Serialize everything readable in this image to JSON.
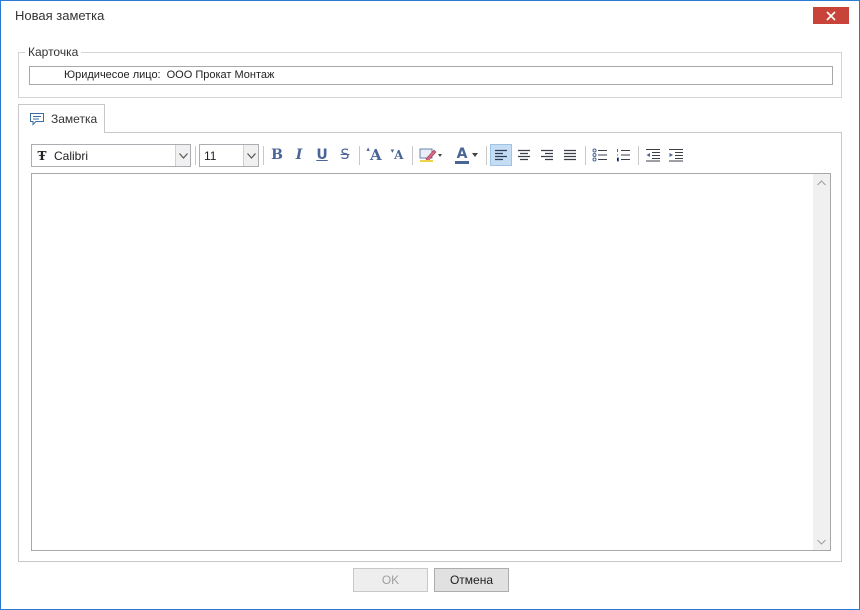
{
  "window": {
    "title": "Новая заметка"
  },
  "card": {
    "legend": "Карточка",
    "entity_label": "Юридичесое лицо:",
    "entity_value": "ООО Прокат Монтаж"
  },
  "tab": {
    "label": "Заметка"
  },
  "toolbar": {
    "font_family": "Calibri",
    "font_size": "11",
    "bold": "B",
    "italic": "I",
    "underline": "U",
    "strikethrough": "S",
    "grow_font": "A",
    "shrink_font": "A",
    "font_color": "A",
    "active_alignment": "align-left"
  },
  "editor": {
    "content": ""
  },
  "buttons": {
    "ok": "OK",
    "cancel": "Отмена"
  },
  "colors": {
    "window_border": "#2b7ad4",
    "close_button": "#c8443a",
    "active_tool": "#c4ddf4"
  }
}
